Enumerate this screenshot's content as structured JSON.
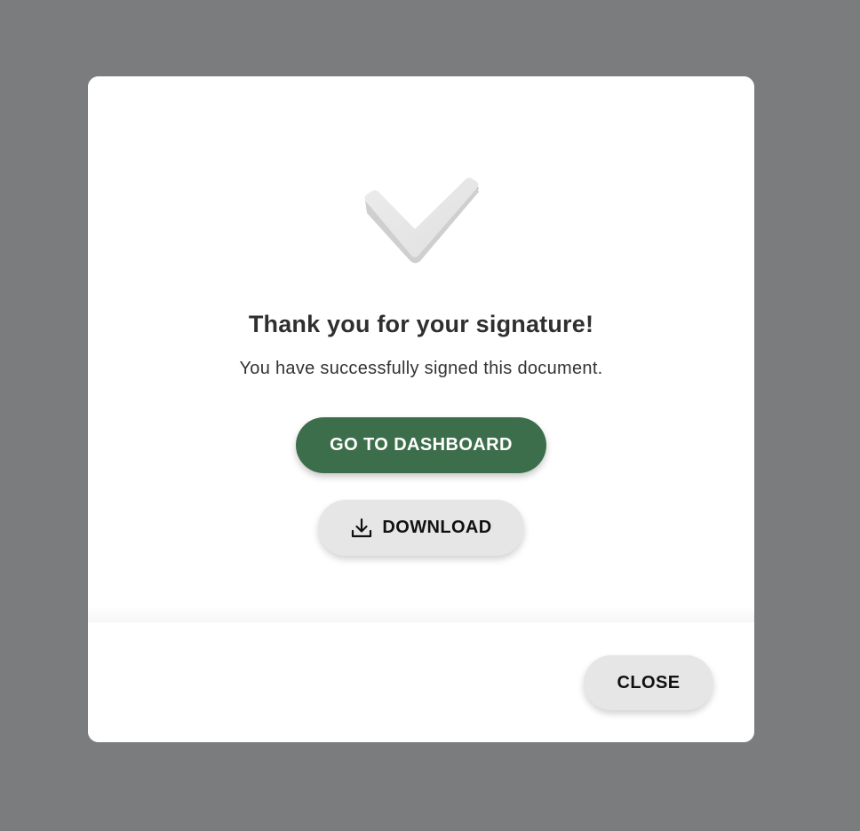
{
  "modal": {
    "title": "Thank you for your signature!",
    "subtitle": "You have successfully signed this document.",
    "icon": "checkmark-icon"
  },
  "actions": {
    "dashboard_label": "GO TO DASHBOARD",
    "download_label": "DOWNLOAD",
    "download_icon": "download-icon"
  },
  "footer": {
    "close_label": "CLOSE"
  },
  "colors": {
    "backdrop": "#7b7c7e",
    "primary": "#3d6e4b",
    "secondary": "#e6e6e6",
    "text": "#2f2f2f"
  }
}
